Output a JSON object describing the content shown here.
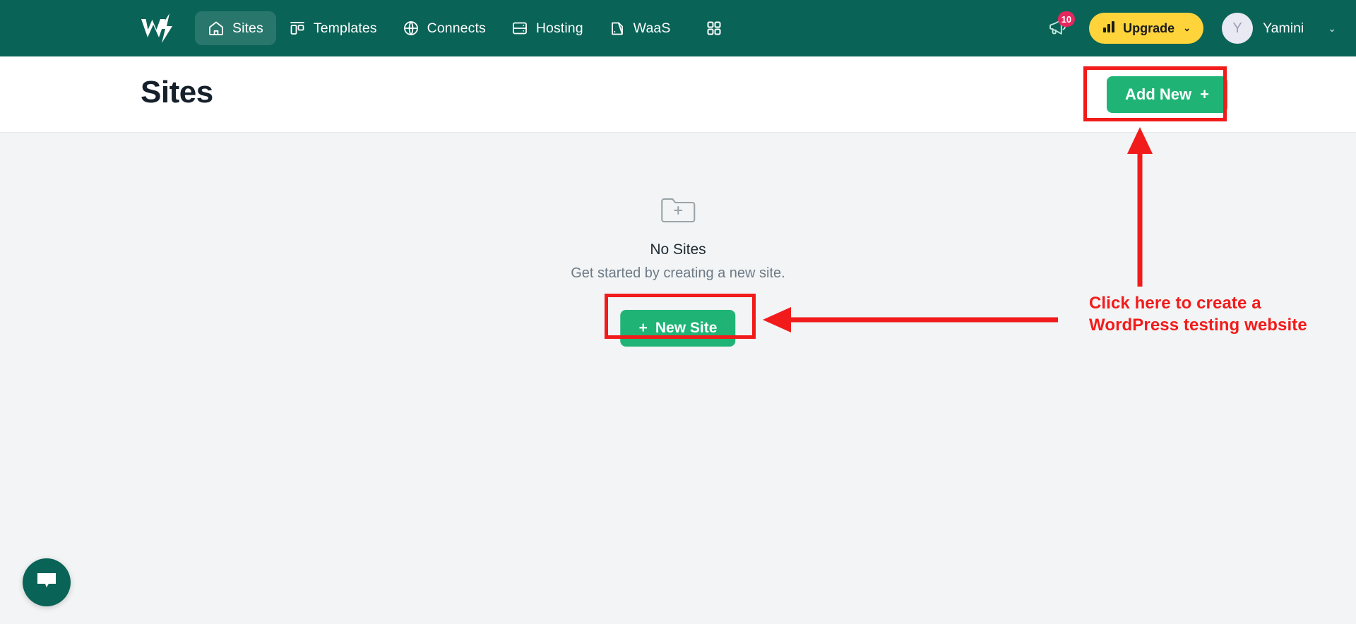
{
  "navbar": {
    "logo_name": "wpeka-w-logo",
    "items": [
      {
        "label": "Sites",
        "icon": "home-icon",
        "active": true
      },
      {
        "label": "Templates",
        "icon": "templates-icon",
        "active": false
      },
      {
        "label": "Connects",
        "icon": "globe-icon",
        "active": false
      },
      {
        "label": "Hosting",
        "icon": "server-icon",
        "active": false
      },
      {
        "label": "WaaS",
        "icon": "waas-icon",
        "active": false
      }
    ],
    "apps_icon": "grid-apps-icon",
    "megaphone_icon": "megaphone-icon",
    "notification_count": "10",
    "upgrade_label": "Upgrade",
    "upgrade_icon": "bar-chart-icon",
    "upgrade_chevron": "⌄",
    "user": {
      "avatar_initial": "Y",
      "name": "Yamini",
      "chevron": "⌄"
    },
    "colors": {
      "background": "#0a6357",
      "active_tab": "rgba(255,255,255,0.13)",
      "upgrade_bg": "#ffd43b",
      "badge_bg": "#e5275f"
    }
  },
  "page_header": {
    "title": "Sites",
    "add_new_label": "Add New",
    "add_new_plus": "+",
    "accent_color": "#1fb476"
  },
  "empty_state": {
    "icon": "folder-plus-icon",
    "title": "No Sites",
    "subtitle": "Get started by creating a new site.",
    "new_site_plus": "+",
    "new_site_label": "New Site"
  },
  "chat": {
    "icon": "chat-bubble-icon",
    "color": "#0a6357"
  },
  "annotations": {
    "color": "#f21b1b",
    "callout_text": "Click here to create a\nWordPress testing website",
    "highlight_add_new": "Add New",
    "highlight_new_site": "New Site"
  }
}
